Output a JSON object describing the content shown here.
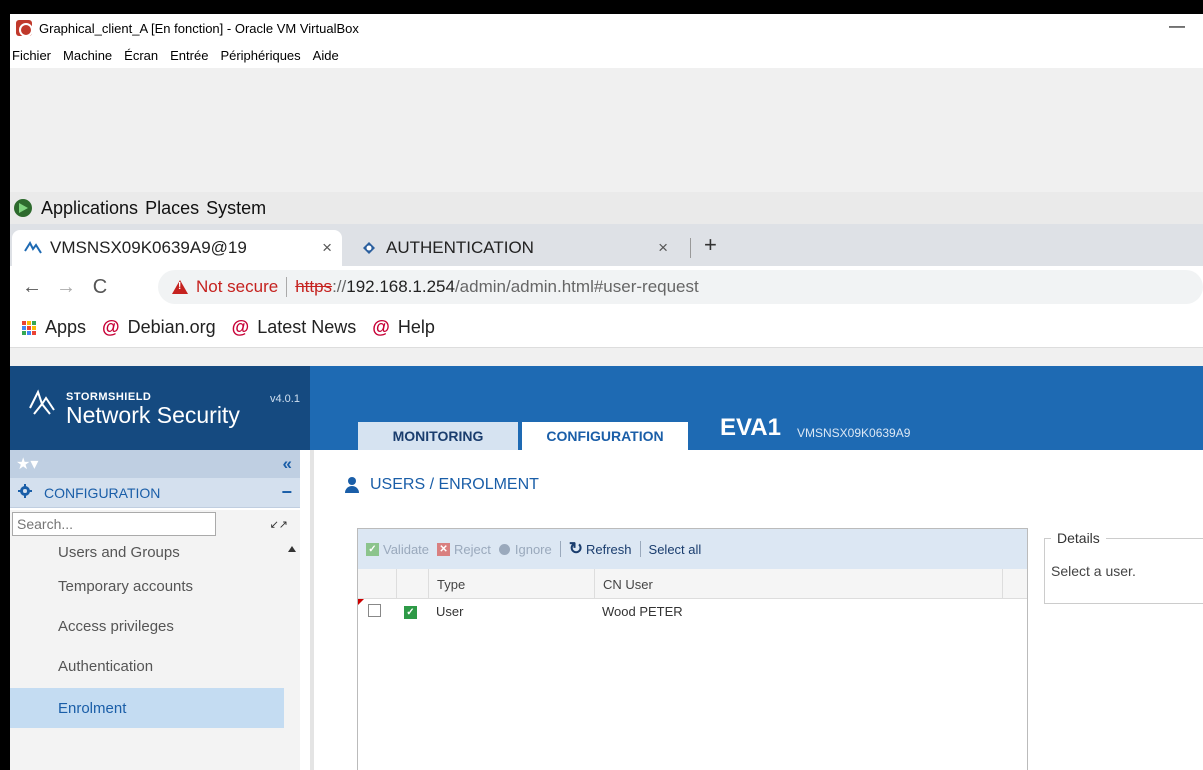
{
  "vbox": {
    "title": "Graphical_client_A [En fonction] - Oracle VM VirtualBox",
    "minimize": "—",
    "menu": [
      "Fichier",
      "Machine",
      "Écran",
      "Entrée",
      "Périphériques",
      "Aide"
    ]
  },
  "gnome": {
    "menu": [
      "Applications",
      "Places",
      "System"
    ]
  },
  "browser": {
    "tabs": [
      {
        "label": "VMSNSX09K0639A9@19"
      },
      {
        "label": "AUTHENTICATION"
      }
    ],
    "tab_close": "×",
    "new_tab": "+",
    "nav": {
      "back": "←",
      "forward": "→",
      "reload": "C"
    },
    "address": {
      "not_secure": "Not secure",
      "scheme": "https",
      "sep": "://",
      "host": "192.168.1.254",
      "path": "/admin/admin.html#user-request"
    },
    "bookmarks": [
      "Apps",
      "Debian.org",
      "Latest News",
      "Help"
    ],
    "debian_glyph": "@"
  },
  "app": {
    "brand_small": "STORMSHIELD",
    "brand_big": "Network Security",
    "version": "v4.0.1",
    "tabs": {
      "monitoring": "MONITORING",
      "configuration": "CONFIGURATION"
    },
    "firewall_name": "EVA1",
    "firewall_serial": "VMSNSX09K0639A9",
    "sidebar": {
      "favorites_star": "★▾",
      "collapse": "«",
      "section": "CONFIGURATION",
      "section_toggle": "−",
      "search_placeholder": "Search...",
      "expand_icon": "↙↗",
      "items": [
        {
          "label": "Users and Groups"
        },
        {
          "label": "Temporary accounts"
        },
        {
          "label": "Access privileges"
        },
        {
          "label": "Authentication"
        },
        {
          "label": "Enrolment"
        }
      ]
    },
    "main": {
      "title": "USERS / ENROLMENT",
      "toolbar": {
        "validate": "Validate",
        "reject": "Reject",
        "ignore": "Ignore",
        "refresh": "Refresh",
        "select_all": "Select all"
      },
      "columns": [
        "Type",
        "CN User"
      ],
      "rows": [
        {
          "type": "User",
          "cn_user": "Wood PETER"
        }
      ],
      "details": {
        "legend": "Details",
        "text": "Select a user."
      }
    }
  },
  "colors": {
    "header_blue": "#1e6ab3",
    "brand_panel": "#154a80",
    "accent": "#1a5ea8",
    "danger": "#c5221f"
  }
}
